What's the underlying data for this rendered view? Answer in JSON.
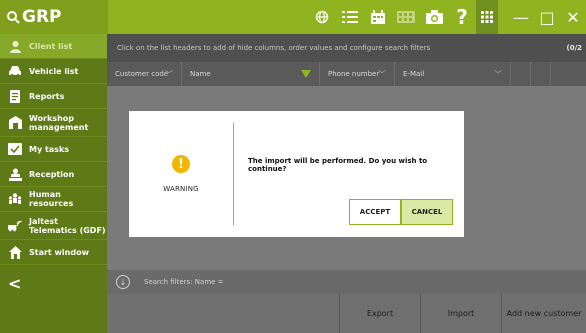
{
  "app": {
    "title": "GRP"
  },
  "toolbar": {
    "icons": [
      "globe-icon",
      "list-icon",
      "calendar-icon",
      "calculator-icon",
      "camera-icon",
      "help-icon",
      "grid-icon"
    ],
    "minimize": "—",
    "maximize": "□",
    "close": "✕"
  },
  "sidebar": {
    "items": [
      {
        "label": "Client list",
        "icon": "user-icon"
      },
      {
        "label": "Vehicle list",
        "icon": "car-icon"
      },
      {
        "label": "Reports",
        "icon": "report-icon"
      },
      {
        "label": "Workshop management",
        "icon": "workshop-icon"
      },
      {
        "label": "My tasks",
        "icon": "tasks-icon"
      },
      {
        "label": "Reception",
        "icon": "reception-icon"
      },
      {
        "label": "Human resources",
        "icon": "people-icon"
      },
      {
        "label": "Jaltest Telematics (GDF)",
        "icon": "telematics-icon"
      },
      {
        "label": "Start window",
        "icon": "home-icon"
      }
    ],
    "back": "<"
  },
  "main": {
    "hint": "Click on the list headers to add of hide columns, order values and configure search filters",
    "count": "(0/2",
    "columns": [
      {
        "label": "Customer code"
      },
      {
        "label": "Name"
      },
      {
        "label": "Phone number"
      },
      {
        "label": "E-Mail"
      }
    ],
    "filters": "Search filters: Name =",
    "buttons": {
      "export": "Export",
      "import": "Import",
      "add": "Add new customer"
    }
  },
  "dialog": {
    "icon_glyph": "!",
    "title": "WARNING",
    "message": "The import will be performed. Do you wish to continue?",
    "accept": "ACCEPT",
    "cancel": "CANCEL"
  },
  "colors": {
    "brand": "#8fb41f",
    "sidebar": "#5e7a16",
    "warning": "#f4b400"
  }
}
